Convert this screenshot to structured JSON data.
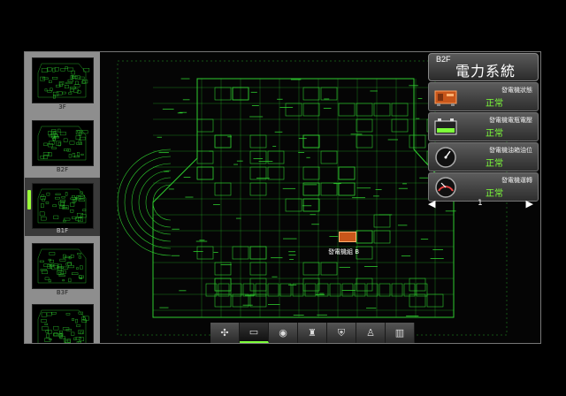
{
  "floors": [
    {
      "label": "3F",
      "active": false
    },
    {
      "label": "B2F",
      "active": false
    },
    {
      "label": "B1F",
      "active": true
    },
    {
      "label": "B3F",
      "active": false
    },
    {
      "label": "",
      "active": false
    }
  ],
  "panel": {
    "floor": "B2F",
    "title": "電力系統",
    "items": [
      {
        "icon": "transformer-icon",
        "name": "發電機狀態",
        "status": "正常"
      },
      {
        "icon": "battery-icon",
        "name": "發電機電瓶電壓",
        "status": "正常"
      },
      {
        "icon": "fuel-gauge-icon",
        "name": "發電機油箱油位",
        "status": "正常"
      },
      {
        "icon": "speedometer-icon",
        "name": "發電機運轉",
        "status": "正常"
      }
    ],
    "page": "1",
    "prev_glyph": "◀",
    "next_glyph": "▶"
  },
  "device": {
    "label": "發電機組 B"
  },
  "toolbar": [
    {
      "icon": "fan-icon",
      "glyph": "✣",
      "active": false
    },
    {
      "icon": "power-system-icon",
      "glyph": "▭",
      "active": true
    },
    {
      "icon": "water-icon",
      "glyph": "◉",
      "active": false
    },
    {
      "icon": "fire-extinguisher-icon",
      "glyph": "♜",
      "active": false
    },
    {
      "icon": "security-shield-icon",
      "glyph": "⛨",
      "active": false
    },
    {
      "icon": "person-icon",
      "glyph": "♙",
      "active": false
    },
    {
      "icon": "door-icon",
      "glyph": "▥",
      "active": false
    }
  ],
  "colors": {
    "plan_line": "#2ecc2e",
    "status_ok": "#7dff3a",
    "accent": "#9bff3a"
  }
}
